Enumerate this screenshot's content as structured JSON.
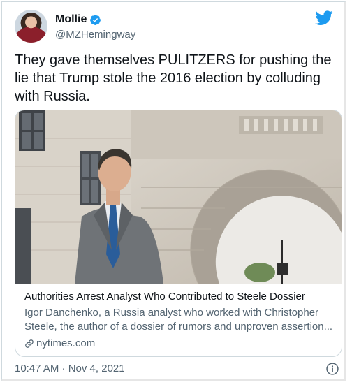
{
  "author": {
    "name": "Mollie",
    "handle": "@MZHemingway",
    "verified": true
  },
  "tweet": {
    "text": "They gave themselves PULITZERS for pushing the lie that Trump stole the 2016 election by colluding with Russia."
  },
  "card": {
    "title": "Authorities Arrest Analyst Who Contributed to Steele Dossier",
    "description": "Igor Danchenko, a Russia analyst who worked with Christopher Steele, the author of a dossier of rumors and unproven assertion...",
    "domain": "nytimes.com"
  },
  "timestamp": "10:47 AM · Nov 4, 2021",
  "icons": {
    "verified": "verified-badge-icon",
    "brand": "twitter-bird-icon",
    "link": "link-icon",
    "info": "info-icon"
  },
  "colors": {
    "brand": "#1d9bf0",
    "text": "#0f1419",
    "secondary": "#536471",
    "border": "#cfd9de"
  }
}
